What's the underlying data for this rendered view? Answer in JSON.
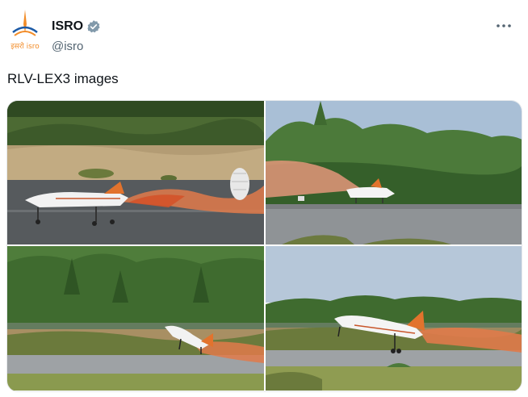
{
  "account": {
    "display_name": "ISRO",
    "handle": "@isro",
    "logo_text": "इसरो isro",
    "verified": true
  },
  "post": {
    "text": "RLV-LEX3 images"
  },
  "media": {
    "images": [
      {
        "alt": "RLV landing with drogue parachute and orange smoke"
      },
      {
        "alt": "RLV on runway with smoke trail, trees behind"
      },
      {
        "alt": "RLV approaching runway over forest"
      },
      {
        "alt": "RLV touching down on runway with smoke"
      }
    ]
  },
  "icons": {
    "verified": "verified-badge-icon",
    "more": "more-options-icon",
    "logo": "isro-logo-icon"
  },
  "colors": {
    "verified_blue": "#829aab",
    "text_primary": "#0f1419",
    "text_secondary": "#536471",
    "smoke": "#e07a4a"
  }
}
